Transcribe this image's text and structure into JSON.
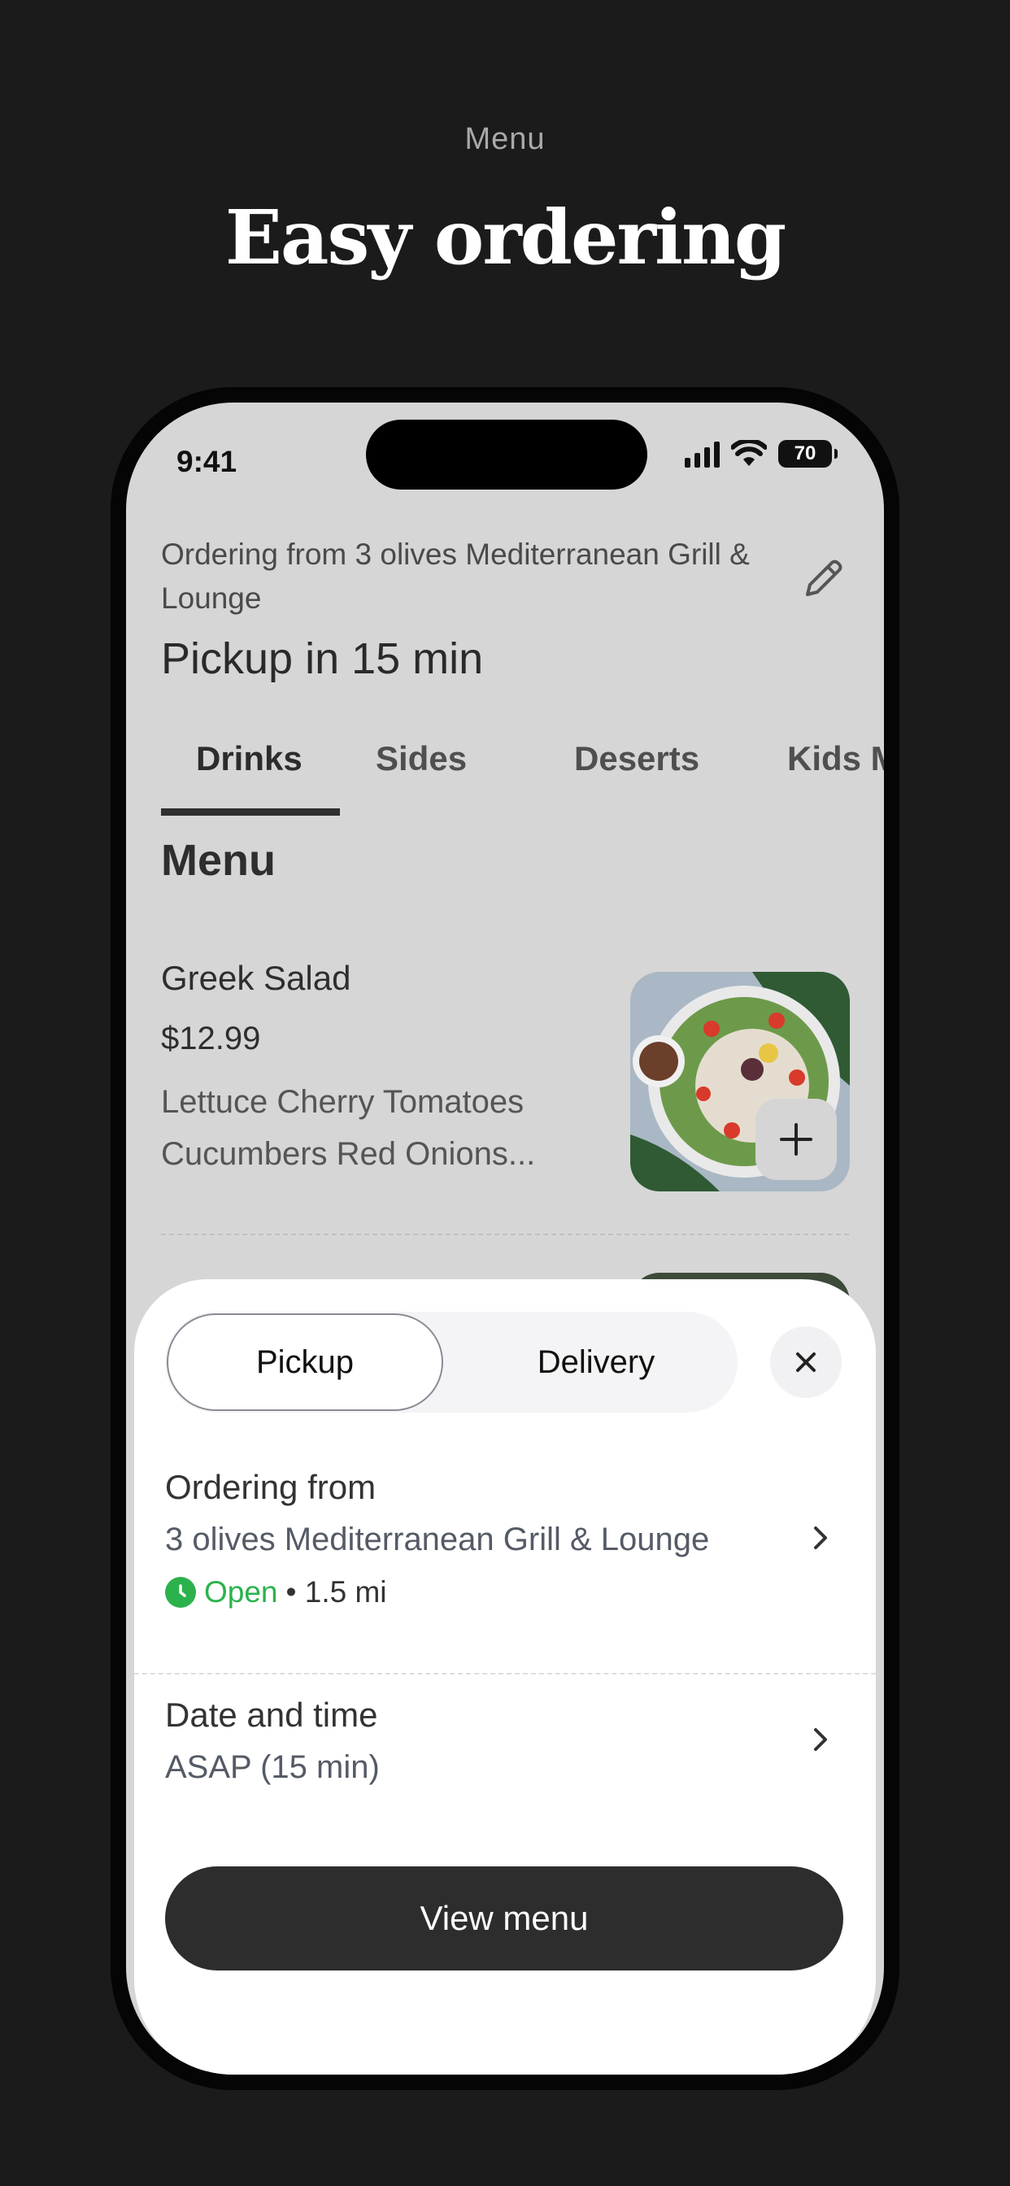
{
  "page": {
    "label": "Menu",
    "headline": "Easy ordering"
  },
  "status_bar": {
    "time": "9:41",
    "battery": "70"
  },
  "header": {
    "ordering_from": "Ordering from 3 olives Mediterranean Grill & Lounge",
    "pickup_title": "Pickup in 15 min"
  },
  "tabs": [
    {
      "label": "Drinks",
      "active": true
    },
    {
      "label": "Sides",
      "active": false
    },
    {
      "label": "Deserts",
      "active": false
    },
    {
      "label": "Kids Meals",
      "active": false
    }
  ],
  "menu": {
    "heading": "Menu",
    "items": [
      {
        "name": "Greek Salad",
        "price": "$12.99",
        "description": "Lettuce Cherry Tomatoes Cucumbers Red Onions..."
      }
    ]
  },
  "sheet": {
    "segmented": {
      "pickup": "Pickup",
      "delivery": "Delivery",
      "selected": "Pickup"
    },
    "ordering_from_title": "Ordering from",
    "restaurant": "3 olives Mediterranean Grill & Lounge",
    "open_status": "Open",
    "distance": "• 1.5 mi",
    "date_time_title": "Date and time",
    "date_time_value": "ASAP (15 min)",
    "view_menu": "View menu"
  },
  "colors": {
    "background": "#1b1b1b",
    "open_green": "#2bb24c",
    "primary_button": "#2d2d2d"
  }
}
